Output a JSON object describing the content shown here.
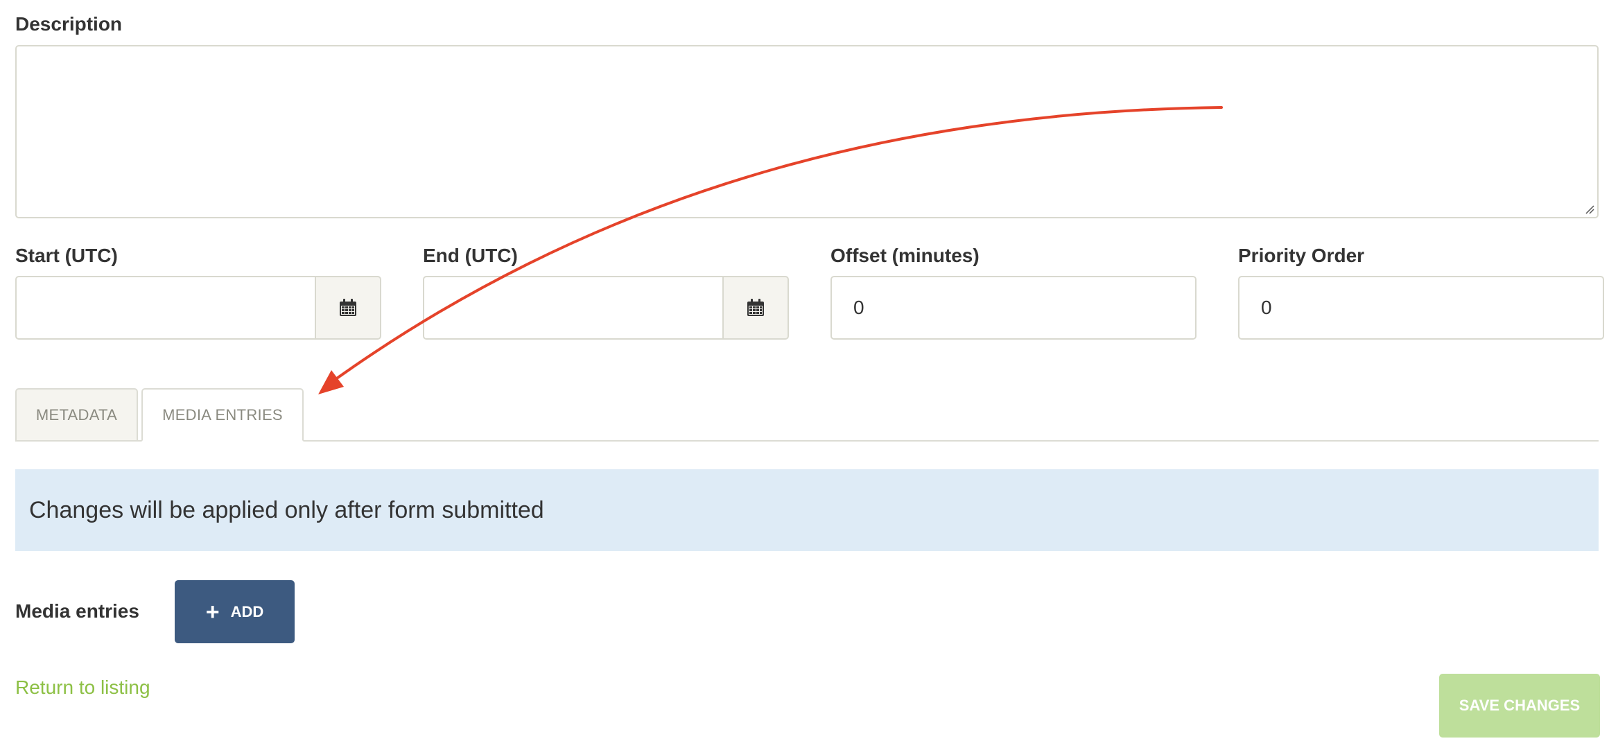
{
  "form": {
    "description_label": "Description",
    "start_label": "Start (UTC)",
    "end_label": "End (UTC)",
    "offset_label": "Offset (minutes)",
    "offset_value": "0",
    "priority_label": "Priority Order",
    "priority_value": "0"
  },
  "tabs": [
    {
      "label": "METADATA",
      "active": false
    },
    {
      "label": "MEDIA ENTRIES",
      "active": true
    }
  ],
  "notice": {
    "text": "Changes will be applied only after form submitted"
  },
  "media": {
    "label": "Media entries",
    "add_label": "ADD"
  },
  "footer": {
    "return_label": "Return to listing",
    "save_label": "SAVE CHANGES"
  },
  "annotation": {
    "color": "#e5432a"
  },
  "colors": {
    "primary_button": "#3d5a80",
    "save_button_disabled": "#bedf9b",
    "link": "#8dc045",
    "info_bg": "#deebf6"
  },
  "icons": {
    "calendar": "calendar-icon",
    "plus": "plus-icon",
    "resize": "resize-grip-icon"
  }
}
